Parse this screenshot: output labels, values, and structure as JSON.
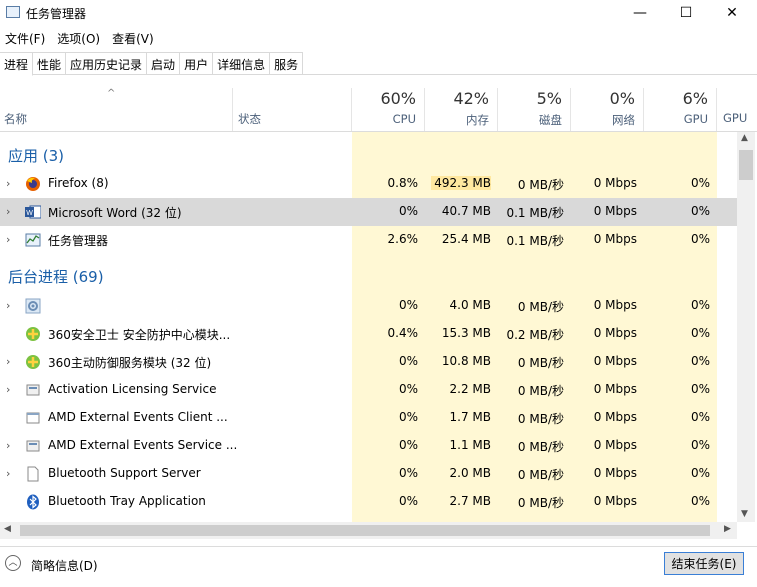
{
  "window": {
    "title": "任务管理器",
    "minimize": "—",
    "maximize": "☐",
    "close": "✕"
  },
  "menu": [
    "文件(F)",
    "选项(O)",
    "查看(V)"
  ],
  "tabs": [
    "进程",
    "性能",
    "应用历史记录",
    "启动",
    "用户",
    "详细信息",
    "服务"
  ],
  "columns": {
    "name": "名称",
    "status": "状态",
    "cpu": {
      "pct": "60%",
      "label": "CPU"
    },
    "mem": {
      "pct": "42%",
      "label": "内存"
    },
    "disk": {
      "pct": "5%",
      "label": "磁盘"
    },
    "net": {
      "pct": "0%",
      "label": "网络"
    },
    "gpu": {
      "pct": "6%",
      "label": "GPU"
    },
    "gpu_engine": "GPU"
  },
  "sections": {
    "apps": "应用 (3)",
    "background": "后台进程 (69)"
  },
  "app_rows": [
    {
      "name": "Firefox (8)",
      "cpu": "0.8%",
      "mem": "492.3 MB",
      "disk": "0 MB/秒",
      "net": "0 Mbps",
      "gpu": "0%"
    },
    {
      "name": "Microsoft Word (32 位)",
      "cpu": "0%",
      "mem": "40.7 MB",
      "disk": "0.1 MB/秒",
      "net": "0 Mbps",
      "gpu": "0%"
    },
    {
      "name": "任务管理器",
      "cpu": "2.6%",
      "mem": "25.4 MB",
      "disk": "0.1 MB/秒",
      "net": "0 Mbps",
      "gpu": "0%"
    }
  ],
  "bg_rows": [
    {
      "name": "",
      "cpu": "0%",
      "mem": "4.0 MB",
      "disk": "0 MB/秒",
      "net": "0 Mbps",
      "gpu": "0%"
    },
    {
      "name": "360安全卫士 安全防护中心模块...",
      "cpu": "0.4%",
      "mem": "15.3 MB",
      "disk": "0.2 MB/秒",
      "net": "0 Mbps",
      "gpu": "0%"
    },
    {
      "name": "360主动防御服务模块 (32 位)",
      "cpu": "0%",
      "mem": "10.8 MB",
      "disk": "0 MB/秒",
      "net": "0 Mbps",
      "gpu": "0%"
    },
    {
      "name": "Activation Licensing Service",
      "cpu": "0%",
      "mem": "2.2 MB",
      "disk": "0 MB/秒",
      "net": "0 Mbps",
      "gpu": "0%"
    },
    {
      "name": "AMD External Events Client ...",
      "cpu": "0%",
      "mem": "1.7 MB",
      "disk": "0 MB/秒",
      "net": "0 Mbps",
      "gpu": "0%"
    },
    {
      "name": "AMD External Events Service ...",
      "cpu": "0%",
      "mem": "1.1 MB",
      "disk": "0 MB/秒",
      "net": "0 Mbps",
      "gpu": "0%"
    },
    {
      "name": "Bluetooth Support Server",
      "cpu": "0%",
      "mem": "2.0 MB",
      "disk": "0 MB/秒",
      "net": "0 Mbps",
      "gpu": "0%"
    },
    {
      "name": "Bluetooth Tray Application",
      "cpu": "0%",
      "mem": "2.7 MB",
      "disk": "0 MB/秒",
      "net": "0 Mbps",
      "gpu": "0%"
    }
  ],
  "footer": {
    "summary": "简略信息(D)",
    "end_task": "结束任务(E)"
  }
}
